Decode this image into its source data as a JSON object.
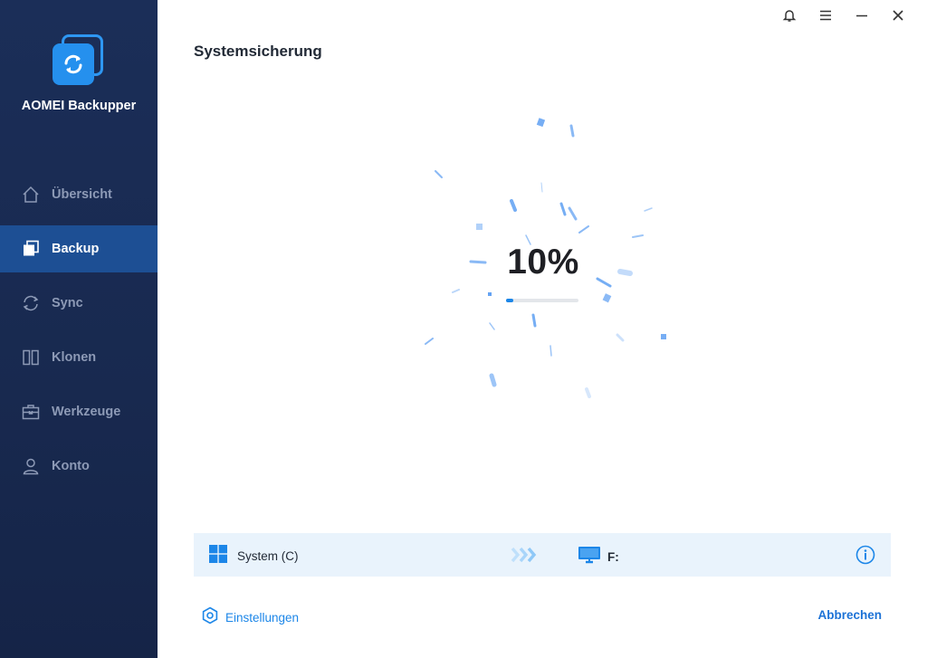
{
  "app": {
    "name": "AOMEI Backupper",
    "logo_icon": "backupper-logo-icon"
  },
  "sidebar": {
    "items": [
      {
        "label": "Übersicht",
        "icon": "home-icon",
        "active": false
      },
      {
        "label": "Backup",
        "icon": "backup-icon",
        "active": true
      },
      {
        "label": "Sync",
        "icon": "sync-icon",
        "active": false
      },
      {
        "label": "Klonen",
        "icon": "clone-icon",
        "active": false
      },
      {
        "label": "Werkzeuge",
        "icon": "toolbox-icon",
        "active": false
      },
      {
        "label": "Konto",
        "icon": "user-icon",
        "active": false
      }
    ]
  },
  "window_controls": [
    "bell-icon",
    "menu-icon",
    "minimize-icon",
    "close-icon"
  ],
  "page": {
    "title": "Systemsicherung"
  },
  "progress": {
    "percent_label": "10%",
    "fraction": 0.1
  },
  "info_bar": {
    "source_label": "System (C)",
    "source_icon": "windows-icon",
    "arrow_icon": "chevrons-right-icon",
    "destination_label": "F:",
    "destination_icon": "monitor-icon",
    "info_icon": "info-icon"
  },
  "footer": {
    "settings_label": "Einstellungen",
    "settings_icon": "gear-icon",
    "cancel_label": "Abbrechen"
  },
  "colors": {
    "sidebar_bg": "#1b2e58",
    "sidebar_active": "#1d4f94",
    "accent": "#1c86e8",
    "info_bar_bg": "#e9f3fc"
  }
}
